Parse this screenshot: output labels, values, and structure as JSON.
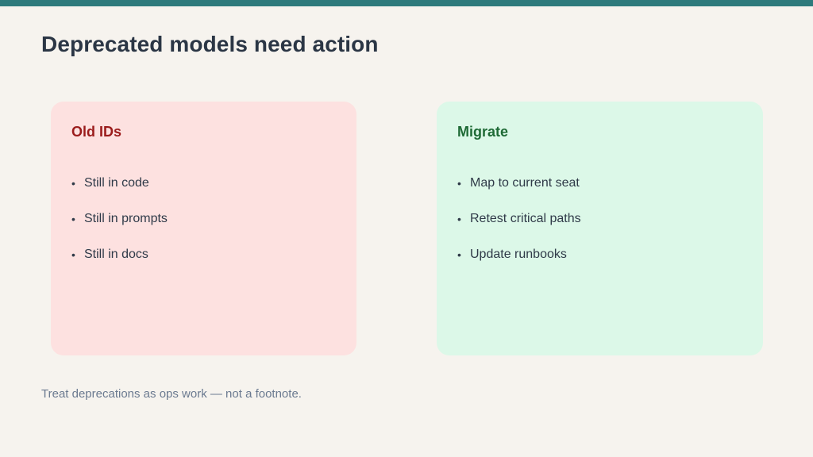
{
  "slide": {
    "title": "Deprecated models need action",
    "footnote": "Treat deprecations as ops work — not a footnote."
  },
  "cards": {
    "left": {
      "title": "Old IDs",
      "items": [
        "Still in code",
        "Still in prompts",
        "Still in docs"
      ]
    },
    "right": {
      "title": "Migrate",
      "items": [
        "Map to current seat",
        "Retest critical paths",
        "Update runbooks"
      ]
    }
  },
  "colors": {
    "accent_bar": "#2e7a7c",
    "left_card_bg": "#fde1e0",
    "left_title": "#9b1c1c",
    "right_card_bg": "#dcf8e8",
    "right_title": "#1e6a35"
  }
}
